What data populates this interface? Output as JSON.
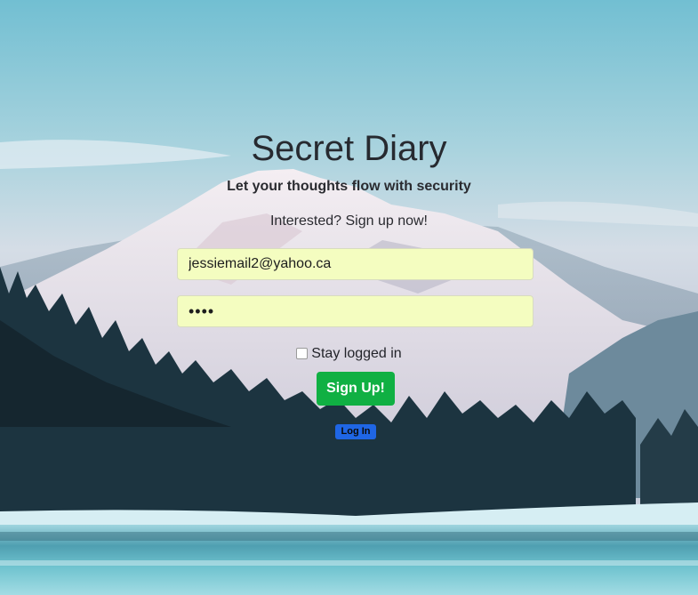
{
  "page": {
    "title": "Secret Diary",
    "tagline": "Let your thoughts flow with security",
    "prompt": "Interested? Sign up now!"
  },
  "form": {
    "email_value": "jessiemail2@yahoo.ca",
    "password_value": "••••",
    "stay_logged_in_label": "Stay logged in",
    "stay_logged_in_checked": false,
    "signup_label": "Sign Up!",
    "login_label": "Log In"
  },
  "colors": {
    "signup_button": "#10b043",
    "login_button": "#1f66e5",
    "input_background": "#f4fdc0"
  }
}
